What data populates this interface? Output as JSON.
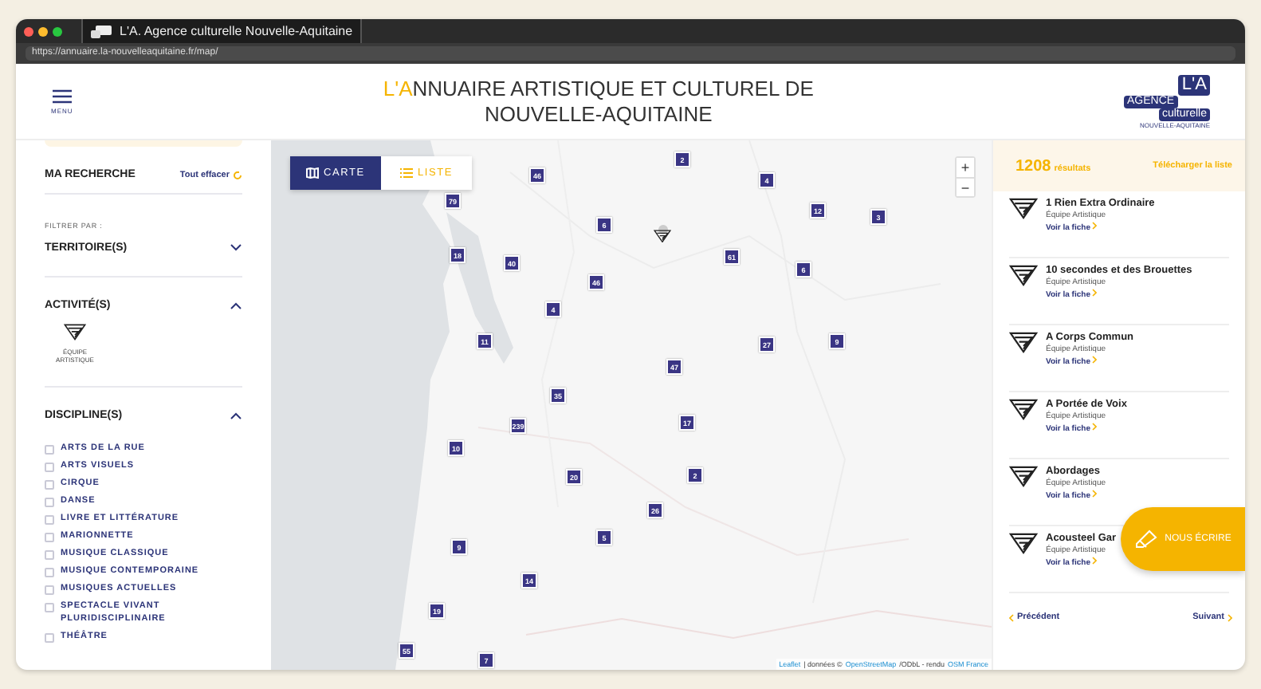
{
  "browser": {
    "tab_title": "L'A. Agence culturelle Nouvelle-Aquitaine",
    "url": "https://annuaire.la-nouvelleaquitaine.fr/map/"
  },
  "header": {
    "menu_label": "MENU",
    "title_accent": "L'A",
    "title_rest": "NNUAIRE ARTISTIQUE ET CULTUREL DE",
    "title_line2": "NOUVELLE-AQUITAINE",
    "logo": {
      "mark": "L'A",
      "line1": "AGENCE",
      "line2": "culturelle",
      "line3": "NOUVELLE-AQUITAINE"
    }
  },
  "sidebar": {
    "heading": "MA RECHERCHE",
    "clear_link": "Tout effacer",
    "filter_label": "FILTRER PAR :",
    "sections": [
      {
        "title": "TERRITOIRE(S)",
        "expanded": false
      },
      {
        "kind": "tiles",
        "title": "ACTIVITÉ(S)",
        "expanded": true,
        "tiles": [
          {
            "label": "ÉQUIPE ARTISTIQUE"
          }
        ]
      },
      {
        "kind": "checklist",
        "title": "DISCIPLINE(S)",
        "expanded": true,
        "items": [
          {
            "label": "ARTS DE LA RUE",
            "checked": false
          },
          {
            "label": "ARTS VISUELS",
            "checked": false
          },
          {
            "label": "CIRQUE",
            "checked": false
          },
          {
            "label": "DANSE",
            "checked": false
          },
          {
            "label": "LIVRE ET LITTÉRATURE",
            "checked": false
          },
          {
            "label": "MARIONNETTE",
            "checked": false
          },
          {
            "label": "MUSIQUE CLASSIQUE",
            "checked": false
          },
          {
            "label": "MUSIQUE CONTEMPORAINE",
            "checked": false
          },
          {
            "label": "MUSIQUES ACTUELLES",
            "checked": false
          },
          {
            "label": "SPECTACLE VIVANT PLURIDISCIPLINAIRE",
            "checked": false
          },
          {
            "label": "THÉÂTRE",
            "checked": false
          }
        ]
      }
    ]
  },
  "map": {
    "view_tabs": [
      {
        "label": "CARTE",
        "selected": true
      },
      {
        "label": "LISTE",
        "selected": false
      }
    ],
    "zoom_in": "+",
    "zoom_out": "−",
    "markers": [
      {
        "label": "2"
      },
      {
        "label": "46"
      },
      {
        "label": "79"
      },
      {
        "label": "6"
      },
      {
        "label": "4"
      },
      {
        "label": "12"
      },
      {
        "label": "3"
      },
      {
        "label": "18"
      },
      {
        "label": "40"
      },
      {
        "label": "61"
      },
      {
        "label": "6"
      },
      {
        "label": "46"
      },
      {
        "label": "4"
      },
      {
        "label": "11"
      },
      {
        "label": "27"
      },
      {
        "label": "9"
      },
      {
        "label": "47"
      },
      {
        "label": "35"
      },
      {
        "label": "239"
      },
      {
        "label": "17"
      },
      {
        "label": "10"
      },
      {
        "label": "20"
      },
      {
        "label": "2"
      },
      {
        "label": "26"
      },
      {
        "label": "5"
      },
      {
        "label": "9"
      },
      {
        "label": "14"
      },
      {
        "label": "19"
      },
      {
        "label": "55"
      },
      {
        "label": "7"
      }
    ],
    "attribution": {
      "leaflet": "Leaflet",
      "middle": "| données ©",
      "osm": "OpenStreetMap",
      "license": "/ODbL - rendu",
      "osm_fr": "OSM France"
    }
  },
  "results": {
    "count": "1208",
    "count_label": "résultats",
    "download": "Télécharger la liste",
    "items": [
      {
        "title": "1 Rien Extra Ordinaire",
        "type": "Équipe Artistique",
        "link": "Voir la fiche"
      },
      {
        "title": "10 secondes et des Brouettes",
        "type": "Équipe Artistique",
        "link": "Voir la fiche"
      },
      {
        "title": "A Corps Commun",
        "type": "Équipe Artistique",
        "link": "Voir la fiche"
      },
      {
        "title": "A Portée de Voix",
        "type": "Équipe Artistique",
        "link": "Voir la fiche"
      },
      {
        "title": "Abordages",
        "type": "Équipe Artistique",
        "link": "Voir la fiche"
      },
      {
        "title": "Acousteel Gar",
        "type": "Équipe Artistique",
        "link": "Voir la fiche"
      }
    ],
    "prev": "Précédent",
    "next": "Suivant"
  },
  "contact_button": "NOUS ÉCRIRE"
}
